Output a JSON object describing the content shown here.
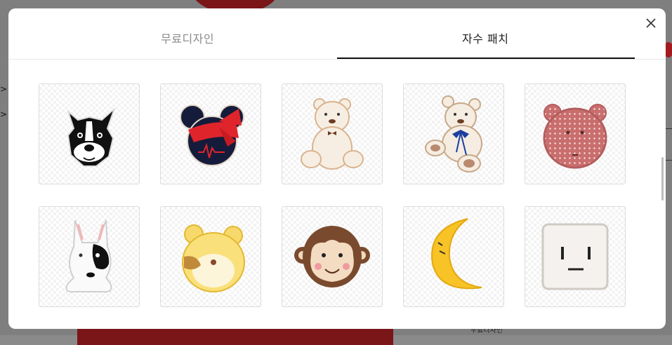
{
  "background": {
    "bottom_text": "무료디자인",
    "arrow_glyph": ">"
  },
  "modal": {
    "close_label": "×",
    "tabs": [
      {
        "label": "무료디자인",
        "active": false
      },
      {
        "label": "자수 패치",
        "active": true
      }
    ],
    "patches": [
      {
        "icon": "boston-terrier-patch-icon"
      },
      {
        "icon": "mouse-ears-bow-patch-icon"
      },
      {
        "icon": "teddy-bear-patch-icon"
      },
      {
        "icon": "sitting-bear-patch-icon"
      },
      {
        "icon": "polka-dot-bear-face-patch-icon"
      },
      {
        "icon": "bull-terrier-patch-icon"
      },
      {
        "icon": "yellow-bear-face-patch-icon"
      },
      {
        "icon": "monkey-face-patch-icon"
      },
      {
        "icon": "crescent-moon-patch-icon"
      },
      {
        "icon": "square-face-patch-icon"
      }
    ]
  },
  "colors": {
    "active_tab": "#222222",
    "inactive_tab": "#8a8a8a",
    "overlay": "#7f7f7f"
  }
}
